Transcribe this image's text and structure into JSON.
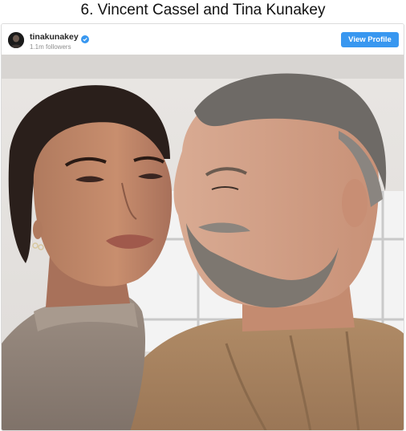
{
  "headline": "6. Vincent Cassel and Tina Kunakey",
  "post": {
    "username": "tinakunakey",
    "followers": "1.1m followers",
    "view_profile_label": "View Profile",
    "verified_icon": "verified-badge-icon",
    "accent_color": "#3897f0"
  },
  "photo": {
    "subject": "selfie-photo"
  }
}
